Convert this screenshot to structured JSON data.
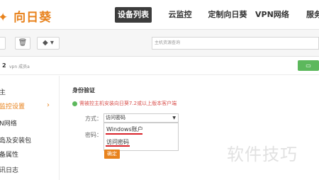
{
  "app": {
    "logo_text": "向日葵"
  },
  "nav": {
    "items": [
      {
        "label": "设备列表"
      },
      {
        "label": "云监控"
      },
      {
        "label": "定制向日葵"
      },
      {
        "label": "VPN网络"
      },
      {
        "label": "服务"
      }
    ]
  },
  "toolbar": {
    "search_placeholder": "主机资源查询"
  },
  "crumb": {
    "count": "2",
    "text": "vpn 成员a"
  },
  "sidebar": {
    "items": [
      {
        "label": "主"
      },
      {
        "label": "监控设置"
      },
      {
        "label": "N网络"
      },
      {
        "label": "岛及安装包"
      },
      {
        "label": "备属性"
      },
      {
        "label": "讯日志"
      }
    ]
  },
  "main": {
    "section_title": "身份验证",
    "notice": "需被控主机安装向日葵7.2或以上版本客户端",
    "method_label": "方式：",
    "method_value": "访问密码",
    "password_label": "密码：",
    "options": [
      {
        "label": "Windows账户"
      },
      {
        "label": "访问密码"
      }
    ],
    "confirm_label": "确定"
  },
  "watermark": "软件技巧",
  "colors": {
    "accent": "#e8821c",
    "nav_active": "#3c3c3c",
    "underline": "#d9232a",
    "green": "#5cb85c"
  }
}
